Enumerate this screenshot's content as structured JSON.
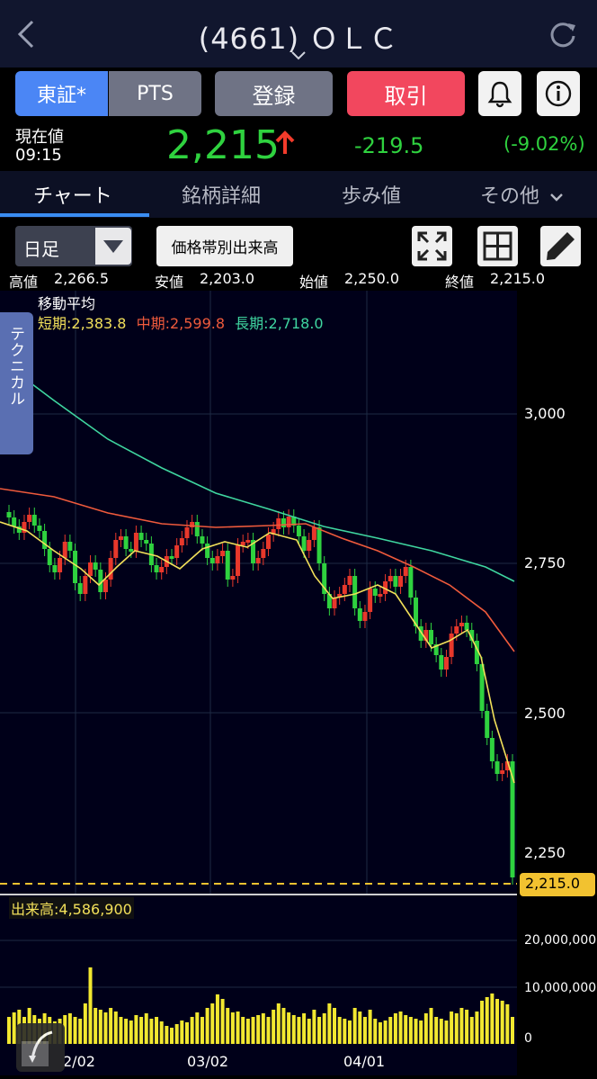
{
  "header": {
    "title": "(4661) ＯＬＣ",
    "back_icon": "chevron-left-icon",
    "refresh_icon": "refresh-icon"
  },
  "buttons": {
    "tosho": "東証*",
    "pts": "PTS",
    "register": "登録",
    "trade": "取引",
    "bell_icon": "bell-icon",
    "info_icon": "info-icon"
  },
  "price": {
    "label": "現在値",
    "time": "09:15",
    "value": "2,215",
    "change": "-219.5",
    "pct": "(-9.02%)"
  },
  "tabs": [
    "チャート",
    "銘柄詳細",
    "歩み値",
    "その他"
  ],
  "toolbar": {
    "period": "日足",
    "volume_by_price": "価格帯別出来高"
  },
  "ohlc": {
    "high_label": "高値",
    "high": "2,266.5",
    "low_label": "安値",
    "low": "2,203.0",
    "open_label": "始値",
    "open": "2,250.0",
    "close_label": "終値",
    "close": "2,215.0"
  },
  "ma": {
    "title": "移動平均",
    "short": "短期:2,383.8",
    "mid": "中期:2,599.8",
    "long": "長期:2,718.0"
  },
  "technical": "テクニカル",
  "price_axis": [
    "3,000",
    "2,750",
    "2,500",
    "2,250"
  ],
  "last_price_badge": "2,215.0",
  "volume": {
    "label": "出来高:4,586,900",
    "axis": [
      "20,000,000",
      "10,000,000",
      "0"
    ]
  },
  "date_axis": [
    "2/02",
    "03/02",
    "04/01"
  ],
  "colors": {
    "up": "#e8382b",
    "down": "#2fd23f",
    "short_ma": "#f2e05a",
    "mid_ma": "#ef5a3c",
    "long_ma": "#3fd6a0",
    "accent": "#3a8df2"
  }
}
